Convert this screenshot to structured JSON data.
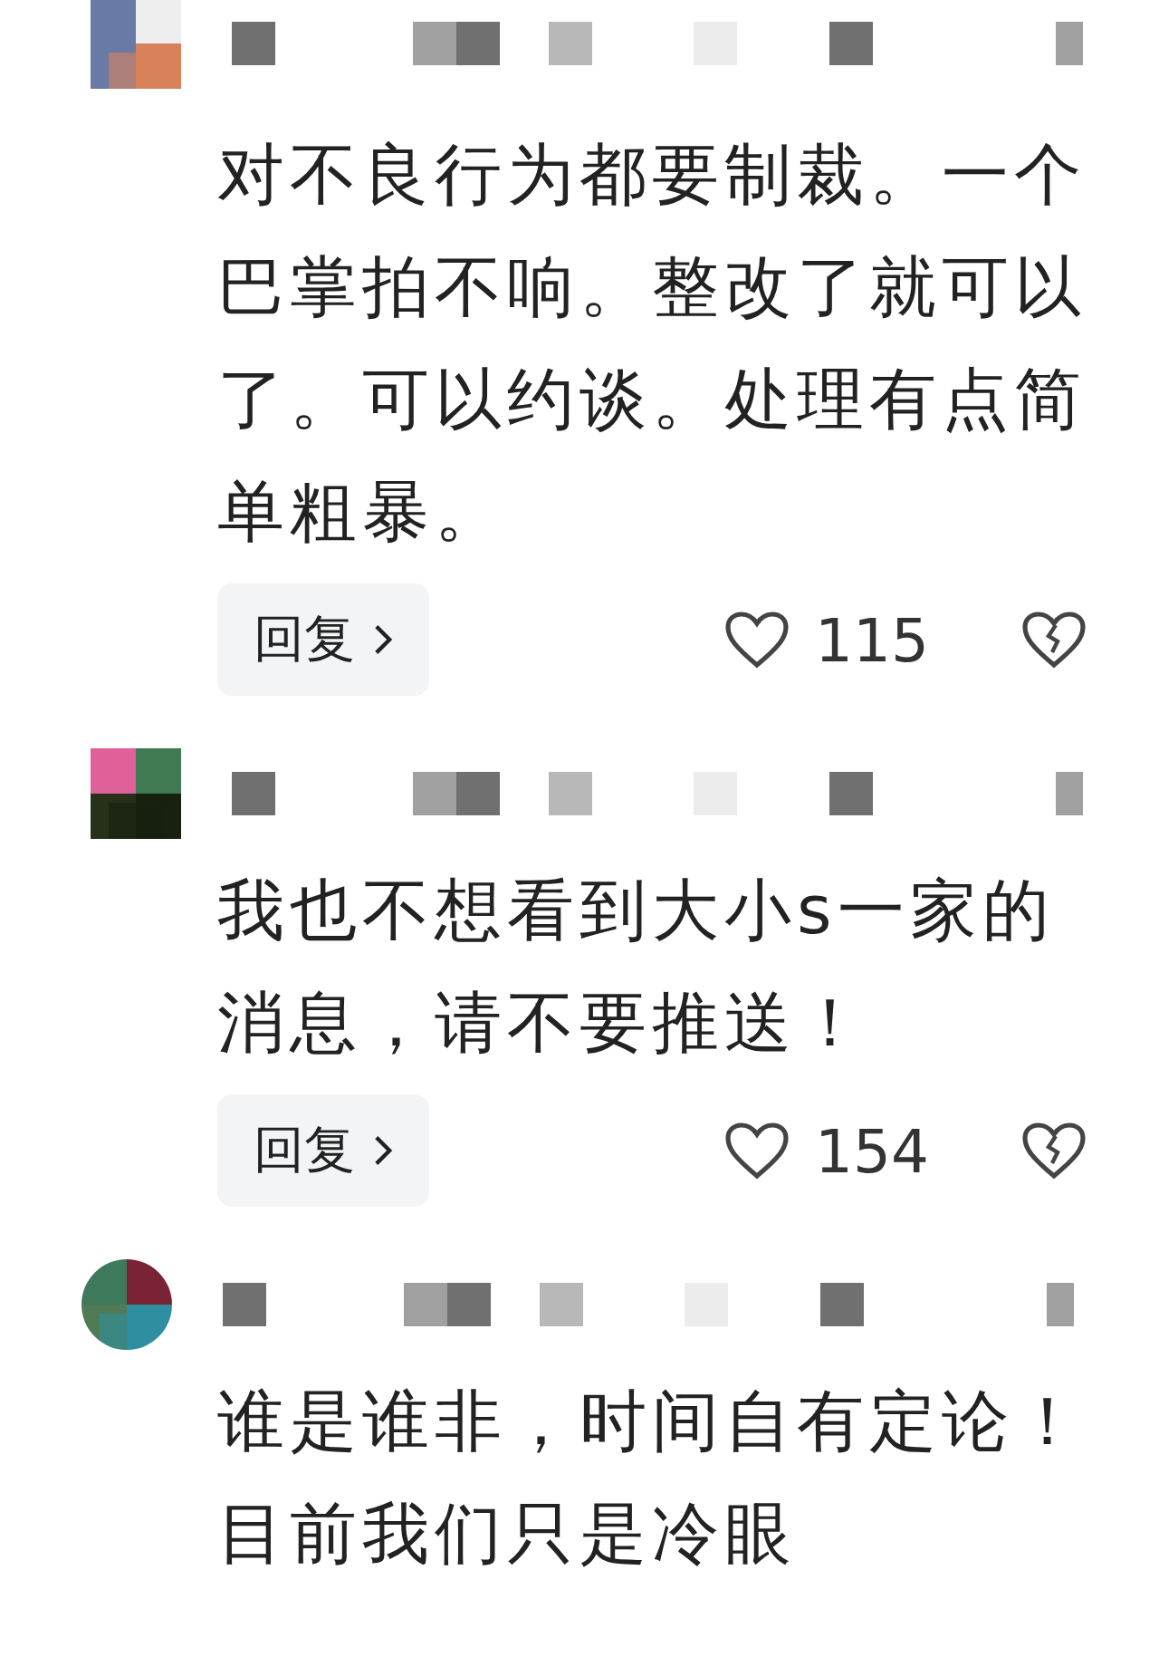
{
  "comments": [
    {
      "text": "对不良行为都要制裁。一个巴掌拍不响。整改了就可以了。可以约谈。处理有点简单粗暴。",
      "reply_label": "回复",
      "likes": "115",
      "liked": false
    },
    {
      "text": "我也不想看到大小s一家的消息，请不要推送！",
      "reply_label": "回复",
      "likes": "154",
      "liked": false
    },
    {
      "text": "谁是谁非，时间自有定论！目前我们只是冷眼"
    }
  ]
}
